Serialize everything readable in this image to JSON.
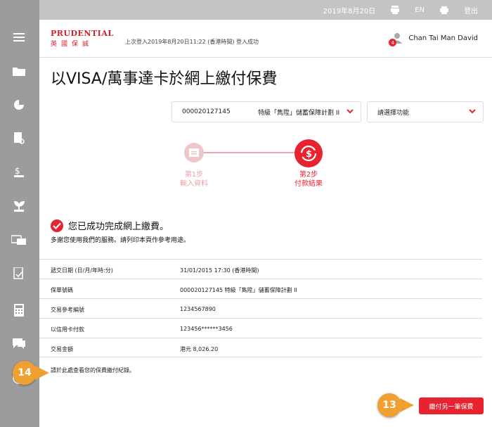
{
  "topbar": {
    "date": "2019年8月20日",
    "language": "EN",
    "logout": "登出"
  },
  "header": {
    "logo_main": "PRUDENTIAL",
    "logo_sub": "英國保誠",
    "last_login": "上次登入2019年8月20日11:22 (香港時間) 登入成功",
    "user_name": "Chan Tai Man David",
    "notification_count": "4"
  },
  "page": {
    "title": "以VISA/萬事達卡於網上繳付保費"
  },
  "policy_select": {
    "policy_no": "000020127145",
    "plan_name": "特級「雋陞」儲蓄保障計劃 II"
  },
  "function_select": {
    "placeholder": "請選擇功能"
  },
  "steps": [
    {
      "title": "第1步",
      "label": "輸入資料"
    },
    {
      "title": "第2步",
      "label": "付款結果"
    }
  ],
  "result": {
    "title": "您已成功完成網上繳費。",
    "desc": "多謝您使用我們的服務。請列印本頁作參考用途。"
  },
  "details": [
    {
      "key": "遞交日期 (日/月/年時:分)",
      "value": "31/01/2015 17:30 (香港時間)"
    },
    {
      "key": "保單號碼",
      "value": "000020127145 特級「雋陞」儲蓄保障計劃 II"
    },
    {
      "key": "交易參考編號",
      "value": "1234567890"
    },
    {
      "key": "以信用卡付款",
      "value": "123456******3456"
    },
    {
      "key": "交易金額",
      "value": "港元 8,026.20"
    }
  ],
  "history_link": "請於此處查看您的保費繳付紀錄。",
  "pay_another_button": "繳付另一筆保費",
  "markers": {
    "m14": "14",
    "m13": "13"
  },
  "colors": {
    "accent": "#e6232f",
    "marker": "#f0a030",
    "sidebar": "#9c9c9c"
  }
}
